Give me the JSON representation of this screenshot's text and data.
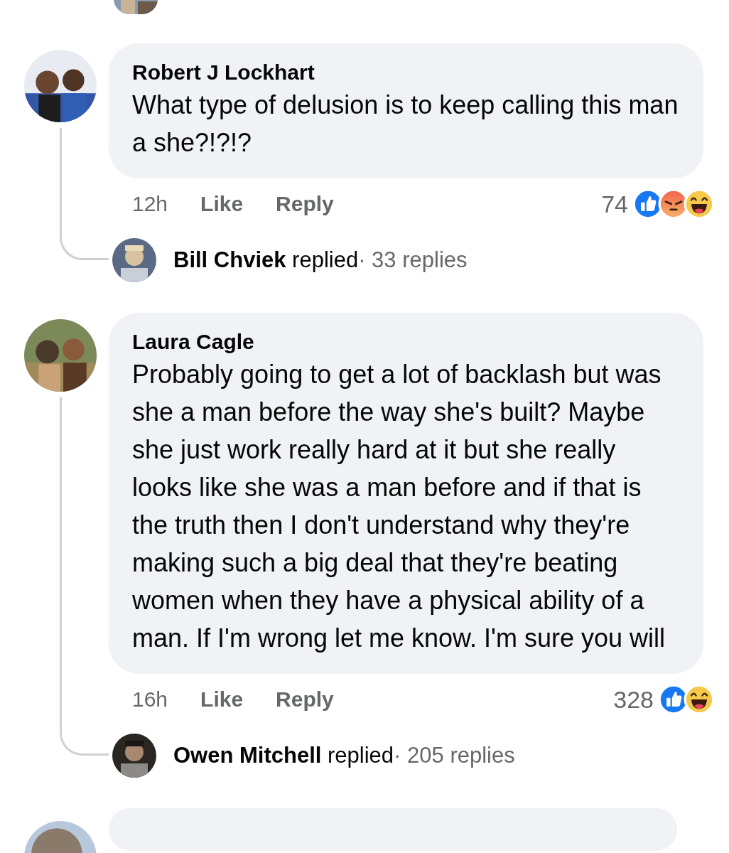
{
  "comments": [
    {
      "author": "Robert J Lockhart",
      "text": "What type of delusion is to keep calling this man a she?!?!?",
      "time": "12h",
      "actions": [
        "Like",
        "Reply"
      ],
      "reaction_count": "74",
      "reactions": [
        {
          "kind": "like"
        },
        {
          "kind": "angry"
        },
        {
          "kind": "haha"
        }
      ],
      "reply_summary": {
        "author": "Bill Chviek",
        "verb": "replied",
        "separator": "·",
        "count": "33 replies"
      }
    },
    {
      "author": "Laura Cagle",
      "text": "Probably going to get a lot of backlash but was she a man before the way she's built? Maybe she just work really hard at it but she really looks like she was a man before and if that is the truth then I don't understand why they're making such a big deal that they're beating women when they have a physical ability of a man. If I'm wrong let me know. I'm sure you will",
      "time": "16h",
      "actions": [
        "Like",
        "Reply"
      ],
      "reaction_count": "328",
      "reactions": [
        {
          "kind": "like"
        },
        {
          "kind": "haha"
        }
      ],
      "reply_summary": {
        "author": "Owen Mitchell",
        "verb": "replied",
        "separator": "·",
        "count": "205 replies"
      }
    }
  ]
}
